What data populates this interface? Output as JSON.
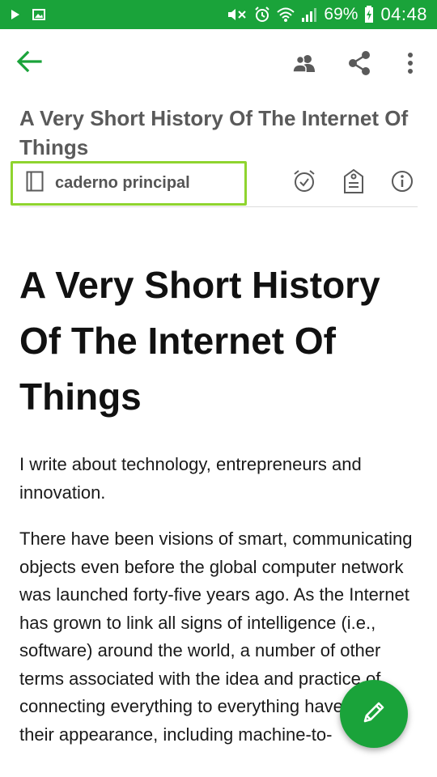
{
  "status_bar": {
    "battery": "69%",
    "time": "04:48",
    "icons": [
      "play-icon",
      "image-icon",
      "mute-icon",
      "alarm-icon",
      "wifi-icon",
      "signal-icon",
      "battery-charging-icon"
    ]
  },
  "toolbar": {
    "icons": [
      "back-arrow-icon",
      "people-icon",
      "share-icon",
      "more-vert-icon"
    ]
  },
  "note": {
    "title": "A Very Short History Of The Internet Of Things",
    "notebook": "caderno principal",
    "meta_icons": [
      "notebook-icon",
      "alarm-check-icon",
      "tag-icon",
      "info-icon"
    ],
    "heading": "A Very Short History Of The Internet Of Things",
    "paragraphs": [
      "I write about technology, entrepreneurs and innovation.",
      "There have been visions of smart, communicating objects even before the global computer network was launched forty-five years ago. As the Internet has grown to link all signs of intelligence (i.e., software) around the world, a number of other terms associated with the idea and practice of connecting everything to everything have made their appearance, including machine-to-"
    ]
  },
  "fab": {
    "icon": "pencil-icon"
  },
  "colors": {
    "brand": "#1aa33a",
    "highlight": "#8fd42f",
    "icon_gray": "#5a5a5a"
  }
}
